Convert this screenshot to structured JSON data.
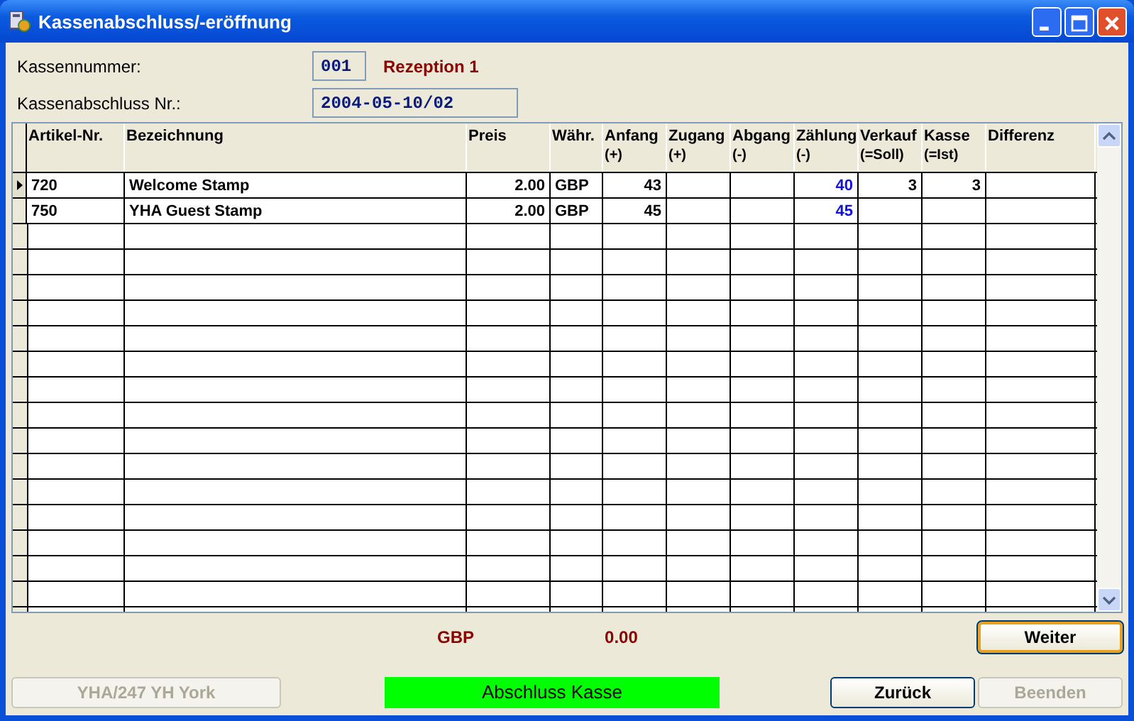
{
  "window": {
    "title": "Kassenabschluss/-eröffnung"
  },
  "fields": [
    {
      "label": "Kassennummer:",
      "value": "001",
      "note": "Rezeption 1"
    },
    {
      "label": "Kassenabschluss Nr.:",
      "value": "2004-05-10/02"
    }
  ],
  "table": {
    "columns": [
      {
        "label": "Artikel-Nr."
      },
      {
        "label": "Bezeichnung"
      },
      {
        "label": "Preis"
      },
      {
        "label": "Währ."
      },
      {
        "label": "Anfang",
        "sub": "(+)"
      },
      {
        "label": "Zugang",
        "sub": "(+)"
      },
      {
        "label": "Abgang",
        "sub": "(-)"
      },
      {
        "label": "Zählung",
        "sub": "(-)"
      },
      {
        "label": "Verkauf",
        "sub": "(=Soll)"
      },
      {
        "label": "Kasse",
        "sub": "(=Ist)"
      },
      {
        "label": "Differenz"
      }
    ],
    "rows": [
      {
        "selected": true,
        "cells": [
          "720",
          "Welcome Stamp",
          "2.00",
          "GBP",
          "43",
          "",
          "",
          "40",
          "3",
          "3",
          ""
        ]
      },
      {
        "selected": false,
        "cells": [
          "750",
          "YHA Guest Stamp",
          "2.00",
          "GBP",
          "45",
          "",
          "",
          "45",
          "",
          "",
          ""
        ]
      }
    ]
  },
  "totals": {
    "currency": "GBP",
    "amount": "0.00"
  },
  "buttons": [
    {
      "label": "Weiter",
      "kind": "focused",
      "disabled": false
    },
    {
      "label": "YHA/247 YH York",
      "kind": "plain",
      "disabled": true
    },
    {
      "label": "Zurück",
      "kind": "plain",
      "disabled": false
    },
    {
      "label": "Beenden",
      "kind": "plain",
      "disabled": true
    }
  ],
  "status": {
    "text": "Abschluss Kasse"
  }
}
